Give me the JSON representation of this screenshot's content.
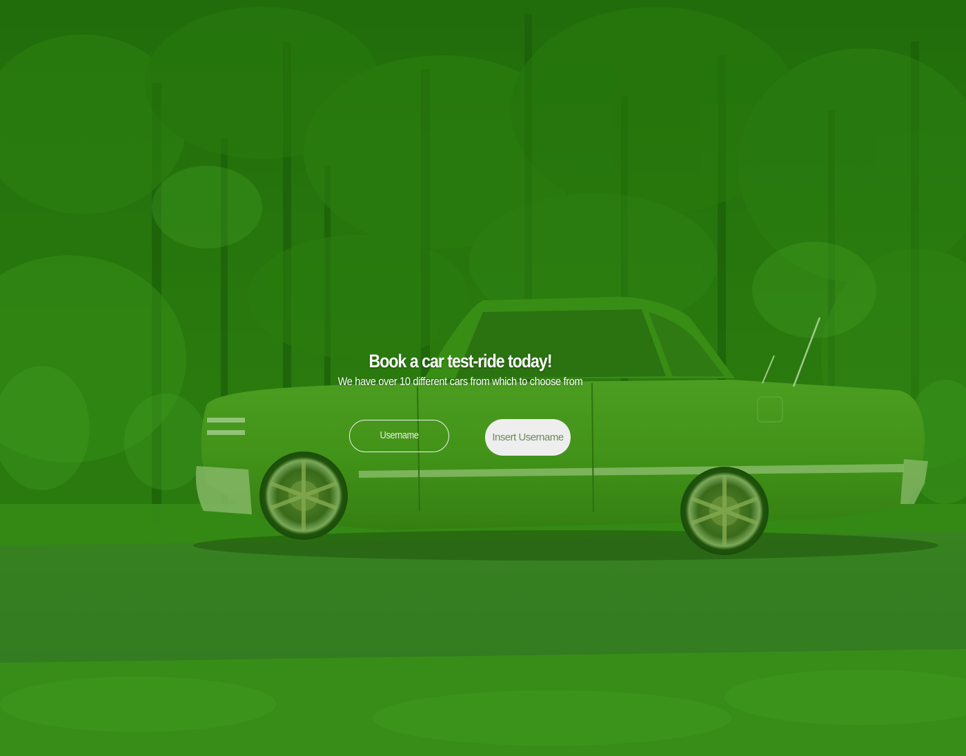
{
  "hero": {
    "title": "Book a car test-ride today!",
    "subtitle": "We have over 10 different cars from which to choose from"
  },
  "form": {
    "username_label": "Username",
    "username_placeholder": "Insert Username"
  },
  "background": {
    "image": "green-tinted-photo-classic-car-forest",
    "tint_color": "#3a8c14"
  }
}
